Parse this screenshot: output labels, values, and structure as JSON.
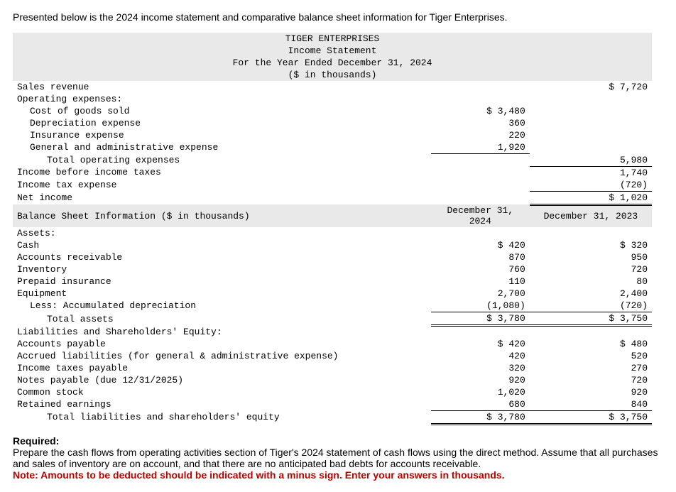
{
  "intro": "Presented below is the 2024 income statement and comparative balance sheet information for Tiger Enterprises.",
  "header": {
    "company": "TIGER ENTERPRISES",
    "title": "Income Statement",
    "period": "For the Year Ended December 31, 2024",
    "units": "($ in thousands)"
  },
  "is": {
    "sales_revenue_label": "Sales revenue",
    "sales_revenue": "$ 7,720",
    "opex_label": "Operating expenses:",
    "cogs_label": "Cost of goods sold",
    "cogs": "$ 3,480",
    "dep_label": "Depreciation expense",
    "dep": "360",
    "ins_label": "Insurance expense",
    "ins": "220",
    "ga_label": "General and administrative expense",
    "ga": "1,920",
    "total_opex_label": "Total operating expenses",
    "total_opex": "5,980",
    "ibt_label": "Income before income taxes",
    "ibt": "1,740",
    "tax_label": "Income tax expense",
    "tax": "(720)",
    "ni_label": "Net income",
    "ni": "$ 1,020"
  },
  "bs_header": {
    "label": "Balance Sheet Information ($ in thousands)",
    "col1": "December 31, 2024",
    "col2": "December 31, 2023"
  },
  "bs": {
    "assets_label": "Assets:",
    "cash_label": "Cash",
    "cash_24": "$ 420",
    "cash_23": "$ 320",
    "ar_label": "Accounts receivable",
    "ar_24": "870",
    "ar_23": "950",
    "inv_label": "Inventory",
    "inv_24": "760",
    "inv_23": "720",
    "ppi_label": "Prepaid insurance",
    "ppi_24": "110",
    "ppi_23": "80",
    "eq_label": "Equipment",
    "eq_24": "2,700",
    "eq_23": "2,400",
    "ad_label": "Less: Accumulated depreciation",
    "ad_24": "(1,080)",
    "ad_23": "(720)",
    "ta_label": "Total assets",
    "ta_24": "$ 3,780",
    "ta_23": "$ 3,750",
    "lse_label": "Liabilities and Shareholders' Equity:",
    "ap_label": "Accounts payable",
    "ap_24": "$ 420",
    "ap_23": "$ 480",
    "al_label": "Accrued liabilities (for general & administrative expense)",
    "al_24": "420",
    "al_23": "520",
    "itp_label": "Income taxes payable",
    "itp_24": "320",
    "itp_23": "270",
    "np_label": "Notes payable (due 12/31/2025)",
    "np_24": "920",
    "np_23": "720",
    "cs_label": "Common stock",
    "cs_24": "1,020",
    "cs_23": "920",
    "re_label": "Retained earnings",
    "re_24": "680",
    "re_23": "840",
    "tlse_label": "Total liabilities and shareholders' equity",
    "tlse_24": "$ 3,780",
    "tlse_23": "$ 3,750"
  },
  "req": {
    "heading": "Required:",
    "text": "Prepare the cash flows from operating activities section of Tiger's 2024 statement of cash flows using the direct method. Assume that all purchases and sales of inventory are on account, and that there are no anticipated bad debts for accounts receivable.",
    "note": "Note: Amounts to be deducted should be indicated with a minus sign. Enter your answers in thousands."
  }
}
